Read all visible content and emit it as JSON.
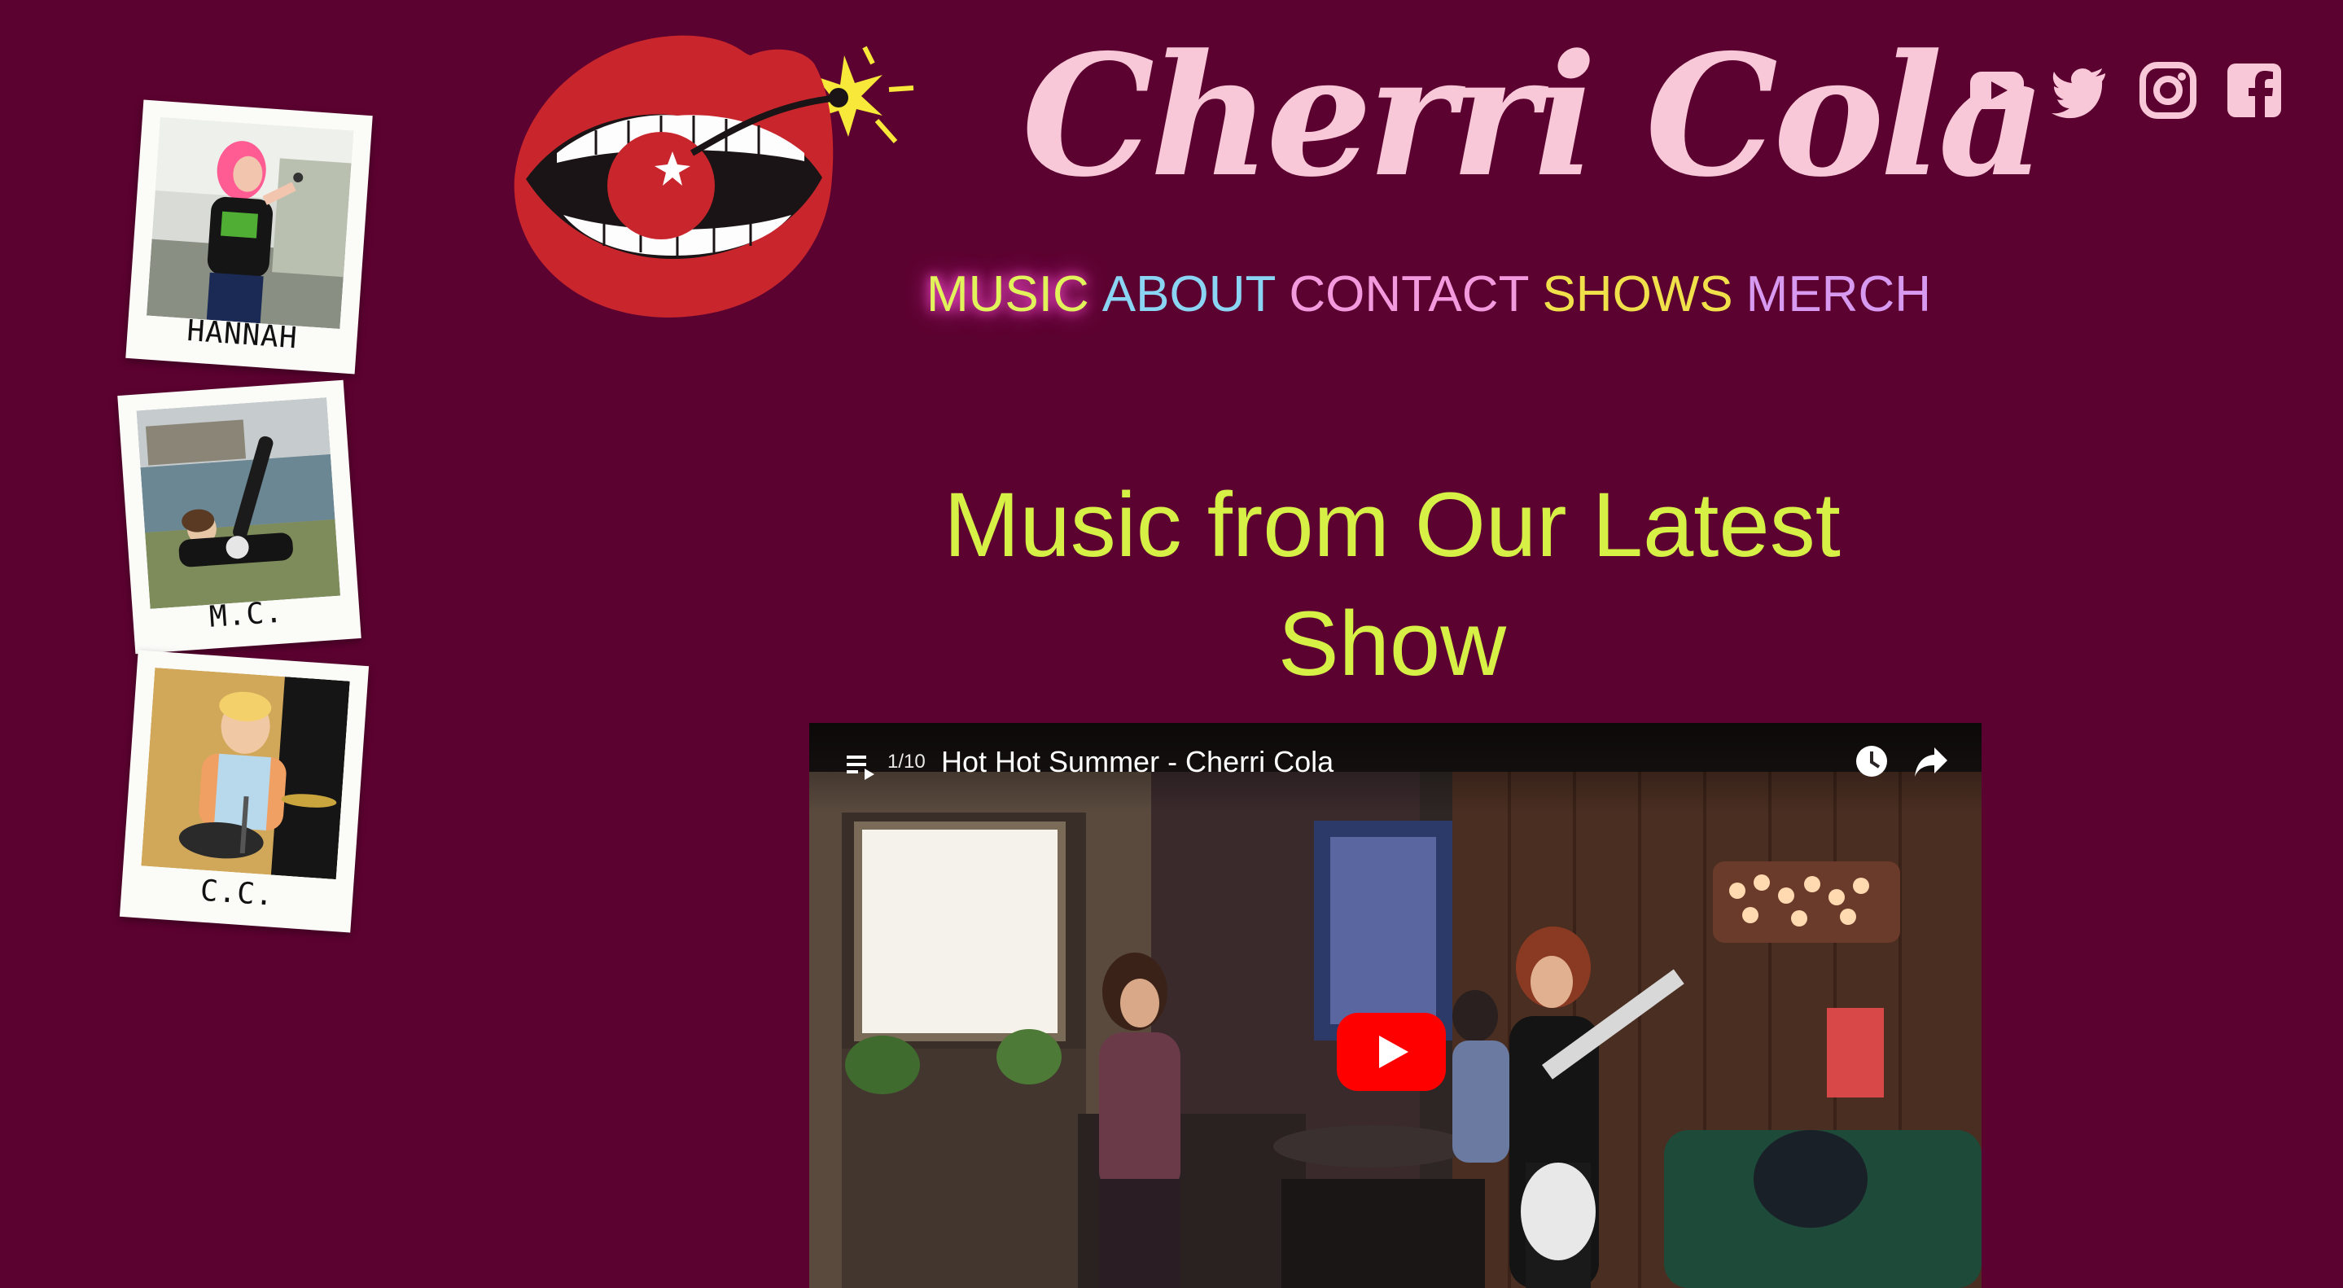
{
  "brand": {
    "name": "Cherri Cola",
    "name_color": "#f9c8d8",
    "background": "#5c0230"
  },
  "nav": [
    {
      "label": "MUSIC",
      "color": "#e2f25a"
    },
    {
      "label": "ABOUT",
      "color": "#8ad4f4"
    },
    {
      "label": "CONTACT",
      "color": "#f39adf"
    },
    {
      "label": "SHOWS",
      "color": "#f0e14a"
    },
    {
      "label": "MERCH",
      "color": "#d79af0"
    }
  ],
  "social": [
    {
      "name": "youtube-icon"
    },
    {
      "name": "twitter-icon"
    },
    {
      "name": "instagram-icon"
    },
    {
      "name": "facebook-icon"
    }
  ],
  "members": [
    {
      "caption": "HANNAH"
    },
    {
      "caption": "M.C."
    },
    {
      "caption": "C.C."
    }
  ],
  "main": {
    "heading": "Music from Our Latest Show",
    "heading_color": "#d6f046"
  },
  "video": {
    "counter": "1/10",
    "title": "Hot Hot Summer - Cherri Cola"
  }
}
